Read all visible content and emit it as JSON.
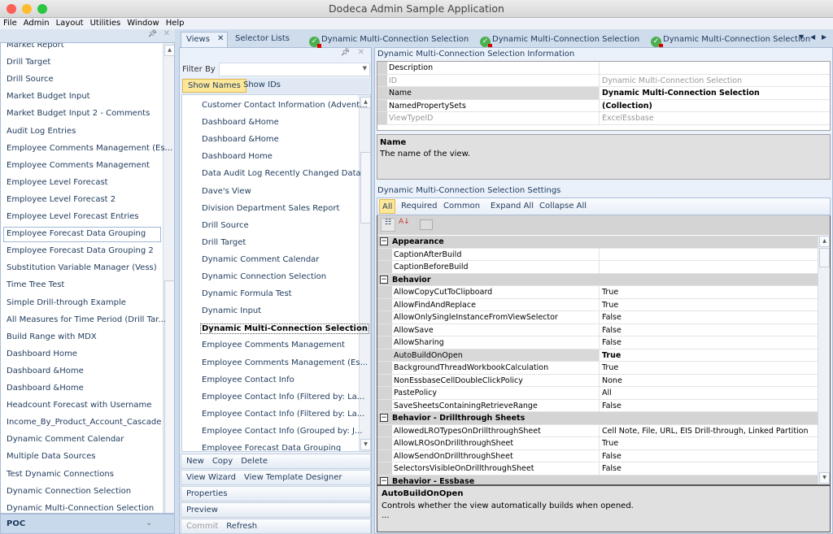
{
  "window": {
    "title": "Dodeca Admin Sample Application"
  },
  "menu": [
    "File",
    "Admin",
    "Layout",
    "Utilities",
    "Window",
    "Help"
  ],
  "left": {
    "items": [
      "Market Report",
      "Drill Target",
      "Drill Source",
      "Market Budget Input",
      "Market Budget Input 2 - Comments",
      "Audit Log Entries",
      "Employee Comments Management (Es...",
      "Employee Comments Management",
      "Employee Level Forecast",
      "Employee Level Forecast 2",
      "Employee Level Forecast Entries",
      "Employee Forecast Data Grouping",
      "Employee Forecast Data Grouping 2",
      "Substitution Variable Manager (Vess)",
      "Time Tree Test",
      "Simple Drill-through Example",
      "All Measures for Time Period (Drill Tar...",
      "Build Range with MDX",
      "Dashboard Home",
      "Dashboard &Home",
      "Dashboard &Home",
      "Headcount Forecast with Username",
      "Income_By_Product_Account_Cascade",
      "Dynamic Comment Calendar",
      "Multiple Data Sources",
      "Test Dynamic Connections",
      "Dynamic Connection Selection",
      "Dynamic Multi-Connection Selection"
    ],
    "selected_index": 11,
    "footer": "POC"
  },
  "middle": {
    "tabs": [
      "Views",
      "Selector Lists"
    ],
    "filter_label": "Filter By",
    "filter_value": "",
    "show_names": "Show Names",
    "show_ids": "Show IDs",
    "items": [
      "Customer Contact Information (Advent...",
      "Dashboard &Home",
      "Dashboard &Home",
      "Dashboard Home",
      "Data Audit Log Recently Changed Data",
      "Dave's View",
      "Division Department Sales Report",
      "Drill Source",
      "Drill Target",
      "Dynamic Comment Calendar",
      "Dynamic Connection Selection",
      "Dynamic Formula Test",
      "Dynamic Input",
      "Dynamic Multi-Connection Selection",
      "Employee Comments Management",
      "Employee Comments Management (Es...",
      "Employee Contact Info",
      "Employee Contact Info (Filtered by: La...",
      "Employee Contact Info (Filtered by: La...",
      "Employee Contact Info (Grouped by: J...",
      "Employee Forecast Data Grouping"
    ],
    "selected_index": 13,
    "actions": [
      [
        "New",
        "Copy",
        "Delete"
      ],
      [
        "View Wizard",
        "View Template Designer"
      ],
      [
        "Properties"
      ],
      [
        "Preview"
      ],
      [
        "Commit",
        "Refresh"
      ]
    ]
  },
  "right": {
    "tabs": [
      "Dynamic Multi-Connection Selection",
      "Dynamic Multi-Connection Selection",
      "Dynamic Multi-Connection Selection"
    ],
    "info_title": "Dynamic Multi-Connection Selection Information",
    "info_rows": [
      {
        "name": "Description",
        "value": "",
        "style": ""
      },
      {
        "name": "ID",
        "value": "Dynamic Multi-Connection Selection",
        "style": "grey"
      },
      {
        "name": "Name",
        "value": "Dynamic Multi-Connection Selection",
        "style": "bold sel"
      },
      {
        "name": "NamedPropertySets",
        "value": "(Collection)",
        "style": "bold"
      },
      {
        "name": "ViewTypeID",
        "value": "ExcelEssbase",
        "style": "grey"
      }
    ],
    "info_desc_title": "Name",
    "info_desc": "The name of the view.",
    "settings_title": "Dynamic Multi-Connection Selection Settings",
    "filters": [
      "All",
      "Required",
      "Common",
      "Expand All",
      "Collapse All"
    ],
    "rows": [
      {
        "cat": "Appearance"
      },
      {
        "name": "CaptionAfterBuild",
        "value": ""
      },
      {
        "name": "CaptionBeforeBuild",
        "value": ""
      },
      {
        "cat": "Behavior"
      },
      {
        "name": "AllowCopyCutToClipboard",
        "value": "True"
      },
      {
        "name": "AllowFindAndReplace",
        "value": "True"
      },
      {
        "name": "AllowOnlySingleInstanceFromViewSelector",
        "value": "False"
      },
      {
        "name": "AllowSave",
        "value": "False"
      },
      {
        "name": "AllowSharing",
        "value": "False"
      },
      {
        "name": "AutoBuildOnOpen",
        "value": "True",
        "sel": true
      },
      {
        "name": "BackgroundThreadWorkbookCalculation",
        "value": "True"
      },
      {
        "name": "NonEssbaseCellDoubleClickPolicy",
        "value": "None"
      },
      {
        "name": "PastePolicy",
        "value": "All"
      },
      {
        "name": "SaveSheetsContainingRetrieveRange",
        "value": "False"
      },
      {
        "cat": "Behavior - Drillthrough Sheets"
      },
      {
        "name": "AllowedLROTypesOnDrillthroughSheet",
        "value": "Cell Note, File, URL, EIS Drill-through, Linked Partition"
      },
      {
        "name": "AllowLROsOnDrillthroughSheet",
        "value": "True"
      },
      {
        "name": "AllowSendOnDrillthroughSheet",
        "value": "False"
      },
      {
        "name": "SelectorsVisibleOnDrillthroughSheet",
        "value": "False"
      },
      {
        "cat": "Behavior - Essbase"
      }
    ],
    "desc_title": "AutoBuildOnOpen",
    "desc": "Controls whether the view automatically builds when opened.",
    "desc_more": "..."
  }
}
